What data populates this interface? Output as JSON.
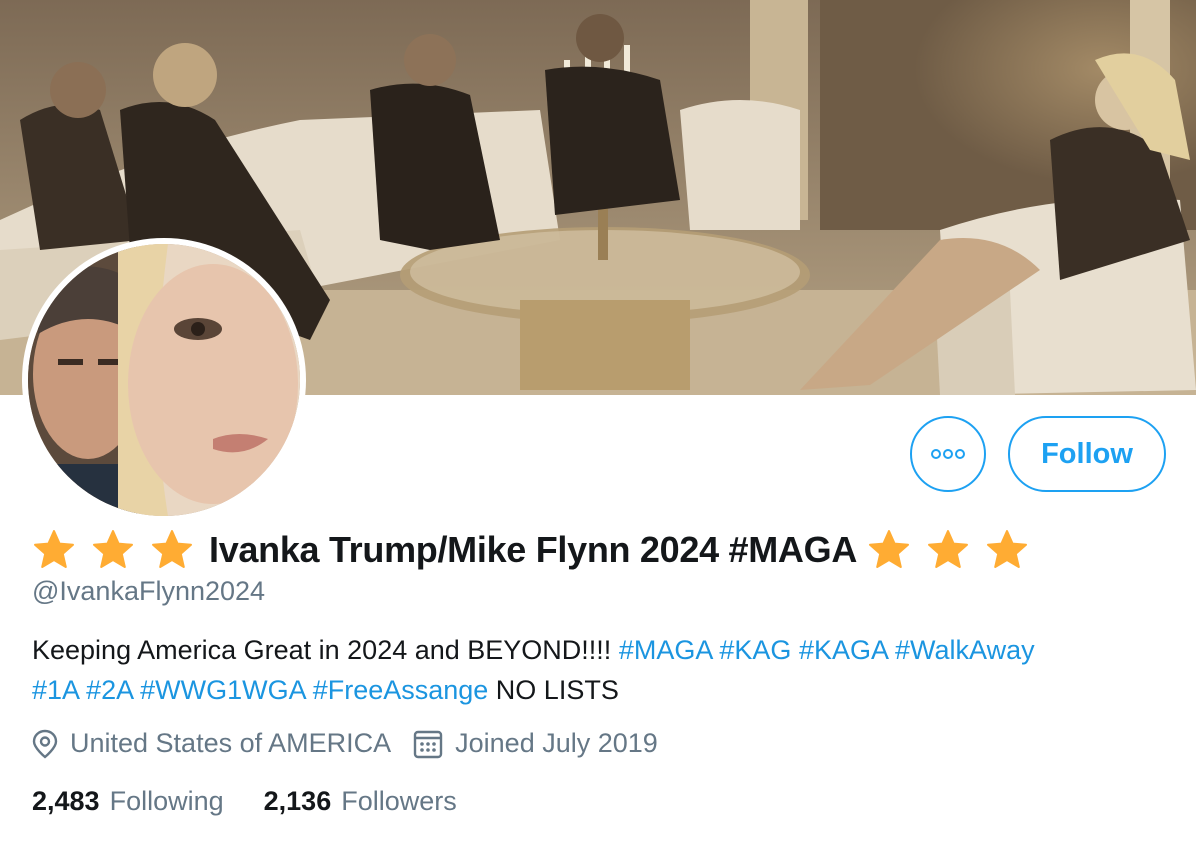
{
  "profile": {
    "display_name": "Ivanka Trump/Mike Flynn 2024 #MAGA",
    "star_icon": "star-emoji",
    "stars_before": 3,
    "stars_after": 3,
    "handle": "@IvankaFlynn2024",
    "bio": {
      "lines": [
        [
          {
            "text": "Keeping America Great in 2024 and BEYOND!!!! ",
            "hashtag": false
          },
          {
            "text": "#MAGA",
            "hashtag": true
          },
          {
            "text": " ",
            "hashtag": false
          },
          {
            "text": "#KAG",
            "hashtag": true
          },
          {
            "text": " ",
            "hashtag": false
          },
          {
            "text": "#KAGA",
            "hashtag": true
          },
          {
            "text": " ",
            "hashtag": false
          },
          {
            "text": "#WalkAway",
            "hashtag": true
          }
        ],
        [
          {
            "text": "#1A",
            "hashtag": true
          },
          {
            "text": " ",
            "hashtag": false
          },
          {
            "text": "#2A",
            "hashtag": true
          },
          {
            "text": " ",
            "hashtag": false
          },
          {
            "text": "#WWG1WGA",
            "hashtag": true
          },
          {
            "text": " ",
            "hashtag": false
          },
          {
            "text": "#FreeAssange",
            "hashtag": true
          },
          {
            "text": " NO LISTS",
            "hashtag": false
          }
        ]
      ]
    },
    "location": "United States of AMERICA",
    "joined": "Joined July 2019",
    "following_count": "2,483",
    "following_label": "Following",
    "followers_count": "2,136",
    "followers_label": "Followers"
  },
  "actions": {
    "more_icon": "more-horizontal-icon",
    "follow_label": "Follow"
  },
  "colors": {
    "accent": "#1da1f2",
    "hashtag": "#1b95e0",
    "muted": "#657786",
    "text": "#14171a",
    "star": "#ffac33"
  }
}
